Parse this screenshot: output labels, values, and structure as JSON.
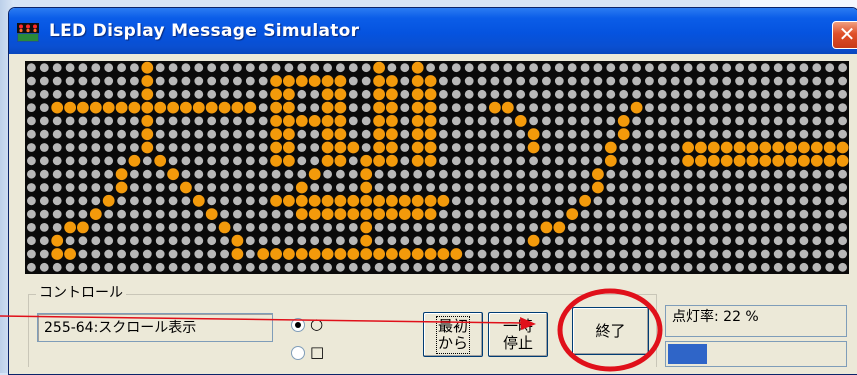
{
  "window": {
    "title": "LED Display Message Simulator",
    "icon": "led-sim-app-icon",
    "close_label": "✕"
  },
  "led_display": {
    "rows": 16,
    "cols": 64,
    "lit_color": "#f39a0b",
    "unlit_color": "#b8b8b8",
    "background": "#0a0a0a",
    "message_glyphs": [
      "大",
      "型",
      "ソ",
      "ー"
    ]
  },
  "control": {
    "group_label": "コントロール",
    "mode_value": "255-64:スクロール表示",
    "radios": [
      {
        "label": "○",
        "checked": true
      },
      {
        "label": "□",
        "checked": false
      }
    ],
    "buttons": {
      "restart": "最初\nから",
      "pause": "一時\n停止",
      "exit": "終了"
    },
    "lighting_rate_text": "点灯率: 22 %",
    "lighting_rate_fraction": 0.22
  },
  "colors": {
    "annotation_red": "#e0101a",
    "progress_blue": "#2f65c8"
  }
}
